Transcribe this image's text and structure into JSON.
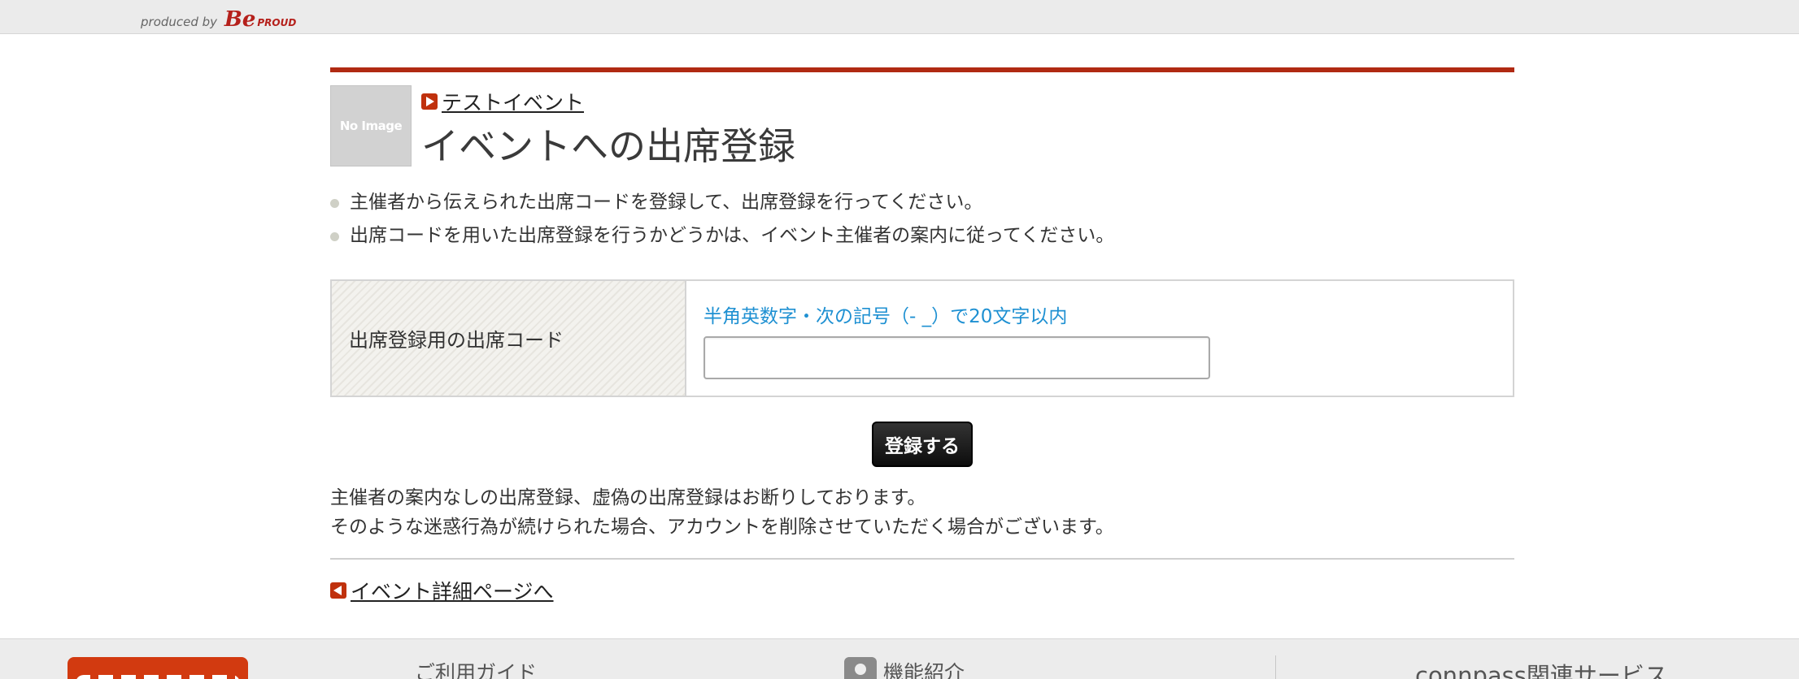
{
  "topbar": {
    "produced_by": "produced by",
    "brand_be": "Be",
    "brand_proud": "PROUD"
  },
  "event": {
    "no_image_label": "No Image",
    "event_name": "テストイベント"
  },
  "page_title": "イベントへの出席登録",
  "notes": [
    "主催者から伝えられた出席コードを登録して、出席登録を行ってください。",
    "出席コードを用いた出席登録を行うかどうかは、イベント主催者の案内に従ってください。"
  ],
  "form": {
    "label": "出席登録用の出席コード",
    "hint": "半角英数字・次の記号（- _）で20文字以内",
    "value": "",
    "submit_label": "登録する"
  },
  "warning": {
    "line1": "主催者の案内なしの出席登録、虚偽の出席登録はお断りしております。",
    "line2": "そのような迷惑行為が続けられた場合、アカウントを削除させていただく場合がございます。"
  },
  "back_link": "イベント詳細ページへ",
  "footer": {
    "guide": "ご利用ガイド",
    "features": "機能紹介",
    "related": "connpass関連サービス"
  },
  "colors": {
    "accent_red": "#b02a12",
    "hint_blue": "#1e90d2"
  }
}
